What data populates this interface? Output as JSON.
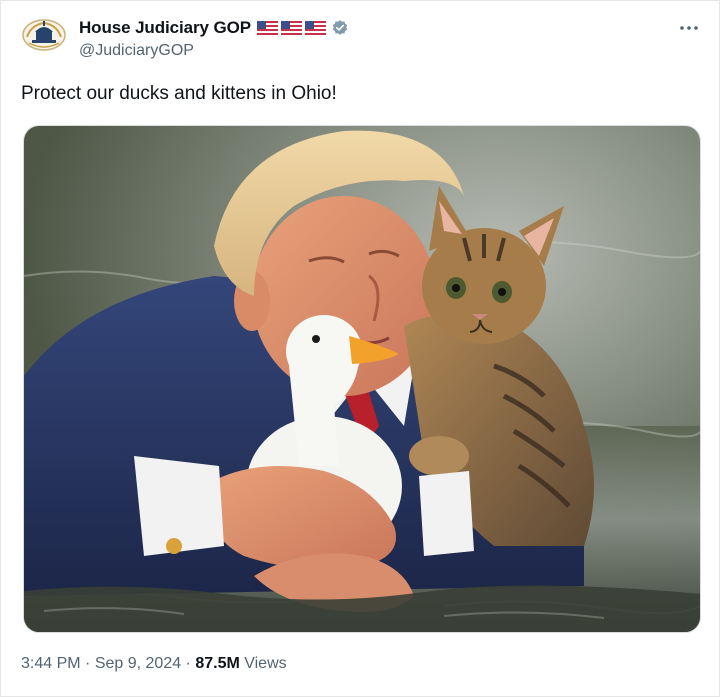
{
  "post": {
    "author": {
      "display_name": "House Judiciary GOP",
      "handle": "@JudiciaryGOP",
      "avatar_icon": "capitol-seal-icon",
      "badges": [
        "us-flag-icon",
        "us-flag-icon",
        "us-flag-icon"
      ],
      "verified_icon": "verified-badge-icon",
      "verified_color": "#829aab"
    },
    "more_icon": "more-options-icon",
    "text": "Protect our ducks and kittens in Ohio!",
    "media": {
      "type": "photo"
    },
    "meta": {
      "time": "3:44 PM",
      "separator_1": " · ",
      "date": "Sep 9, 2024",
      "separator_2": " · ",
      "views_count": "87.5M",
      "views_label": " Views"
    }
  },
  "colors": {
    "text_primary": "#0f1419",
    "text_secondary": "#536471",
    "background": "#ffffff"
  }
}
